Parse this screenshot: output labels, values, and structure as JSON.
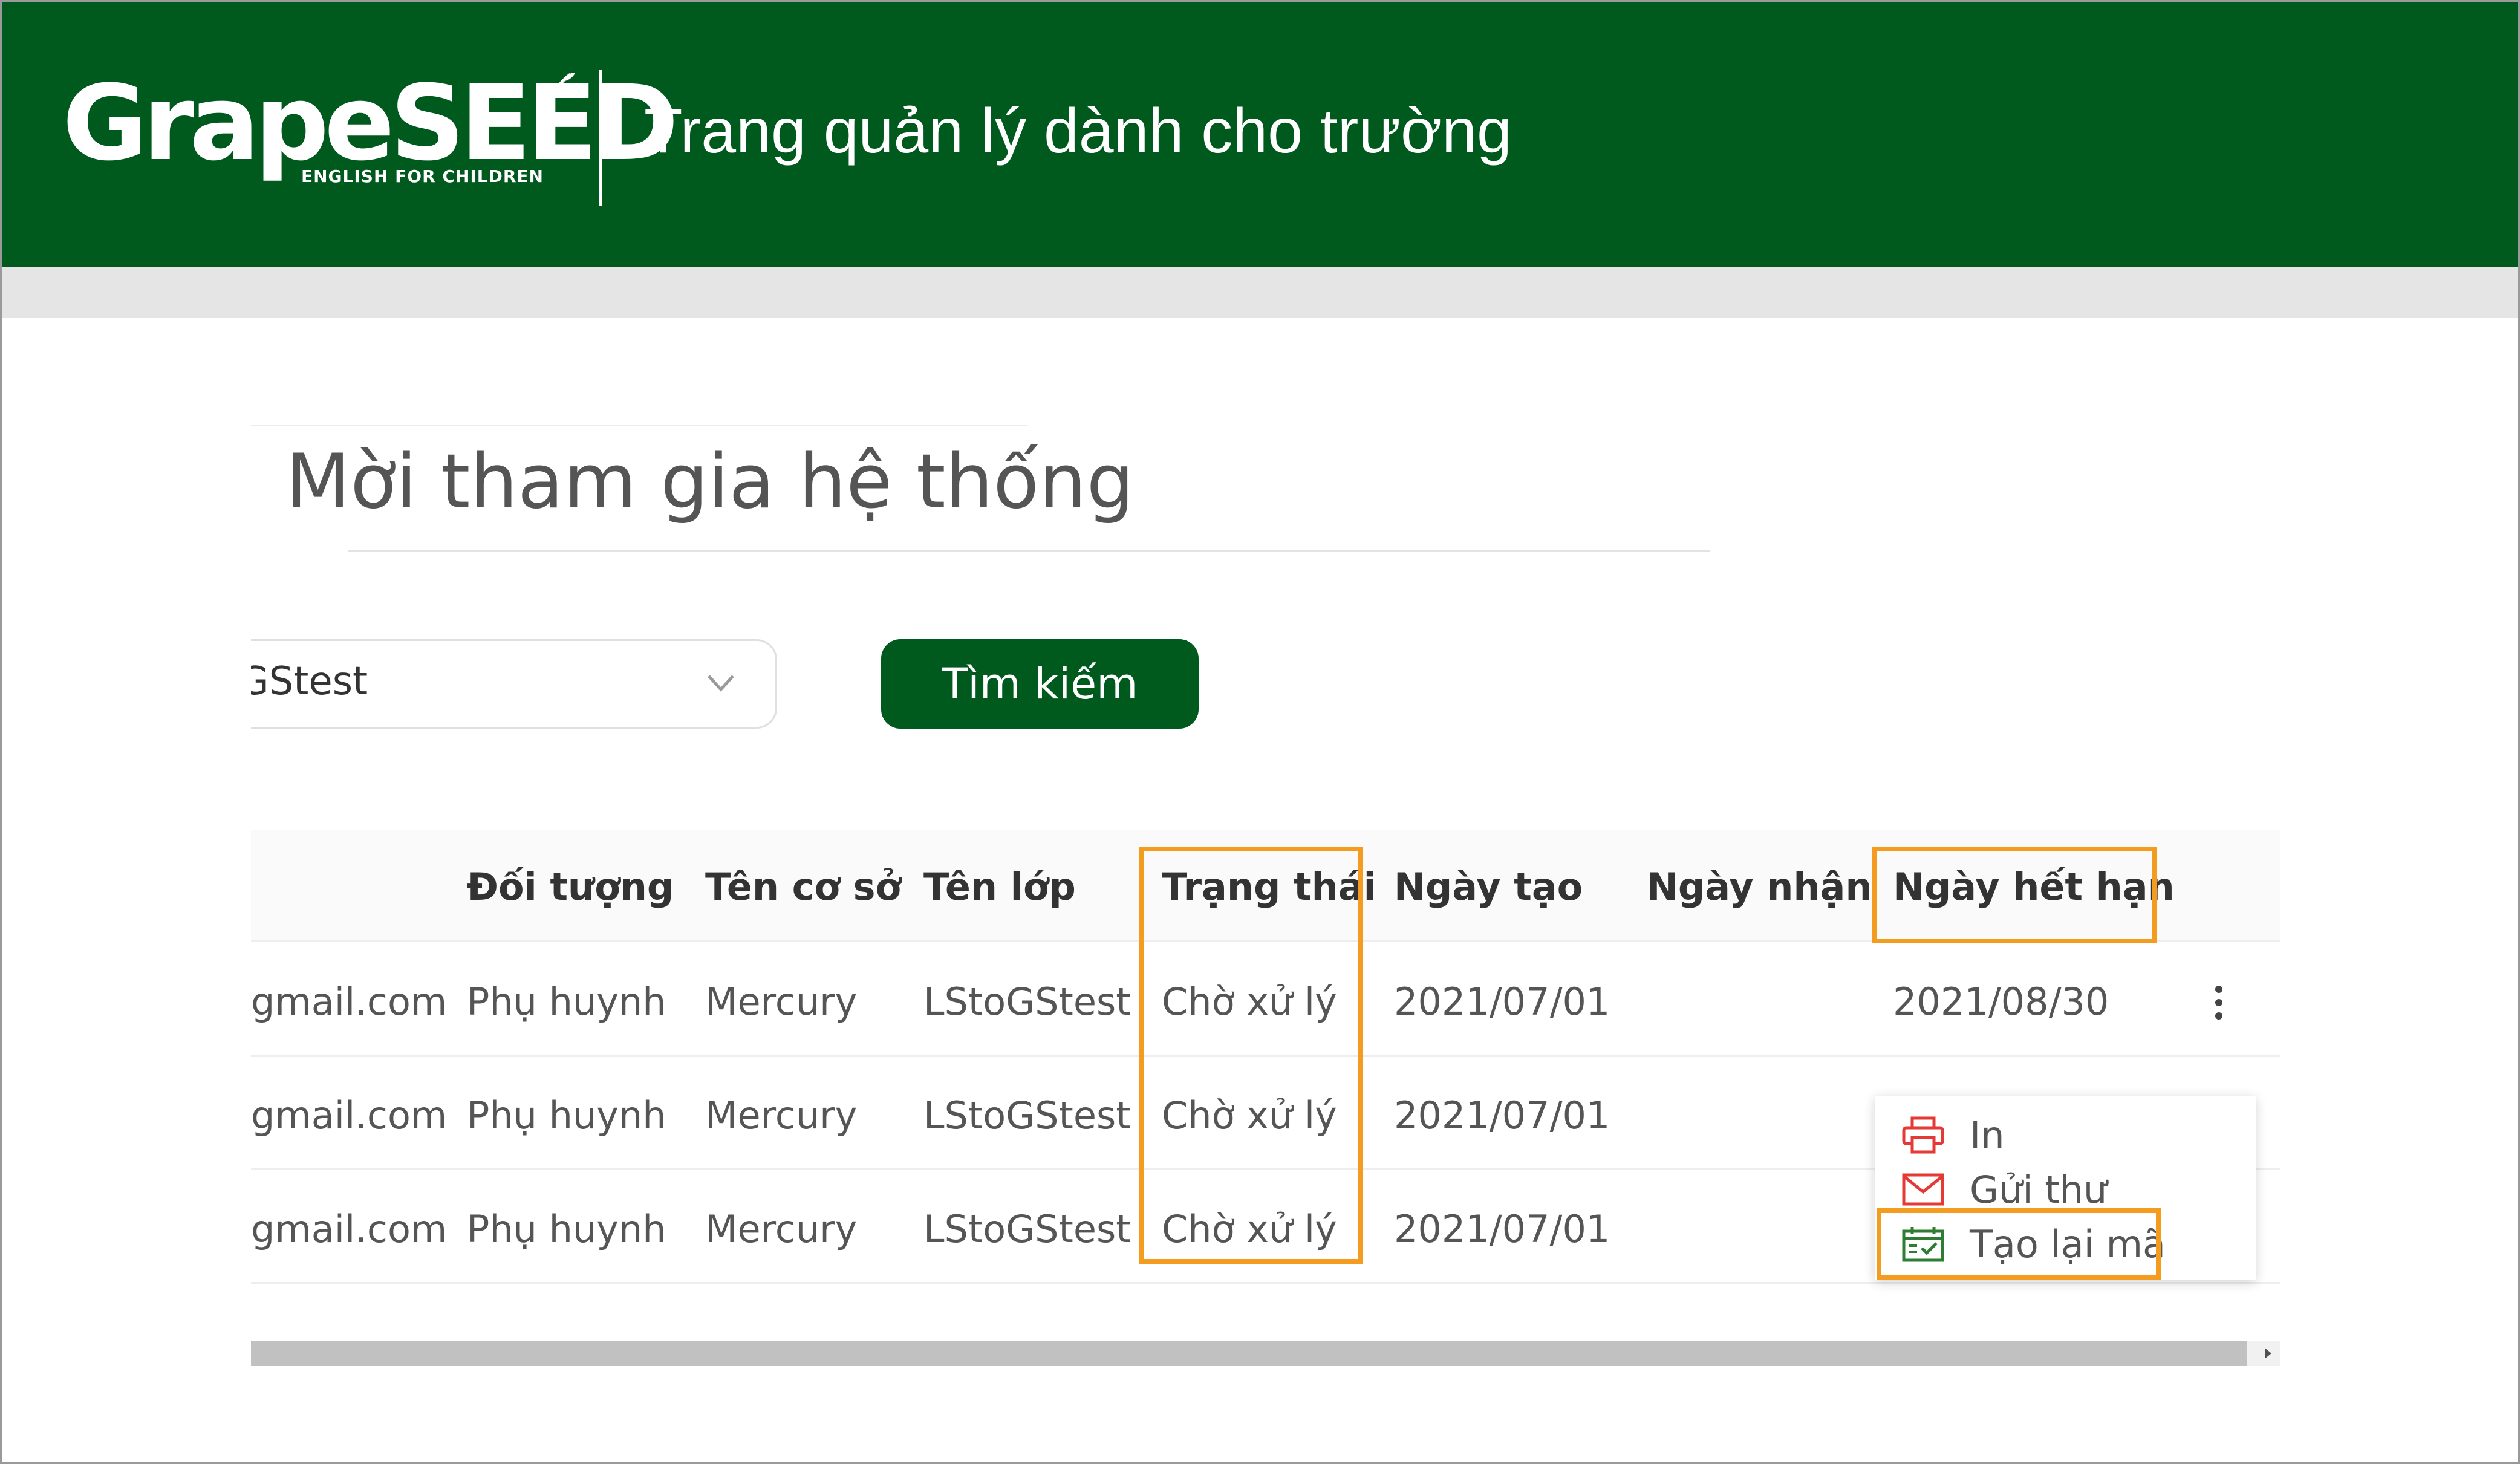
{
  "header": {
    "logo_text": "GrapeSEED",
    "logo_tagline": "ENGLISH FOR CHILDREN",
    "title": "Trang quản lý dành cho trường"
  },
  "page": {
    "title": "Mời tham gia hệ thống"
  },
  "filter": {
    "class_value": "GStest",
    "search_label": "Tìm kiếm"
  },
  "table": {
    "columns": [
      "Đối tượng",
      "Tên cơ sở",
      "Tên lớp",
      "Trạng thái",
      "Ngày tạo",
      "Ngày nhận",
      "Ngày hết hạn"
    ],
    "rows": [
      {
        "email": "gmail.com",
        "audience": "Phụ huynh",
        "campus": "Mercury",
        "class": "LStoGStest",
        "status": "Chờ xử lý",
        "created": "2021/07/01",
        "received": "",
        "expires": "2021/08/30"
      },
      {
        "email": "gmail.com",
        "audience": "Phụ huynh",
        "campus": "Mercury",
        "class": "LStoGStest",
        "status": "Chờ xử lý",
        "created": "2021/07/01",
        "received": "",
        "expires": ""
      },
      {
        "email": "gmail.com",
        "audience": "Phụ huynh",
        "campus": "Mercury",
        "class": "LStoGStest",
        "status": "Chờ xử lý",
        "created": "2021/07/01",
        "received": "",
        "expires": ""
      }
    ]
  },
  "menu": {
    "items": [
      {
        "label": "In",
        "icon": "printer-icon"
      },
      {
        "label": "Gửi thư",
        "icon": "mail-icon"
      },
      {
        "label": "Tạo lại mã",
        "icon": "calendar-check-icon"
      }
    ]
  },
  "colors": {
    "brand_green": "#005a1e",
    "highlight": "#f39c1f",
    "icon_red": "#e53935",
    "icon_green": "#2e7d32"
  }
}
